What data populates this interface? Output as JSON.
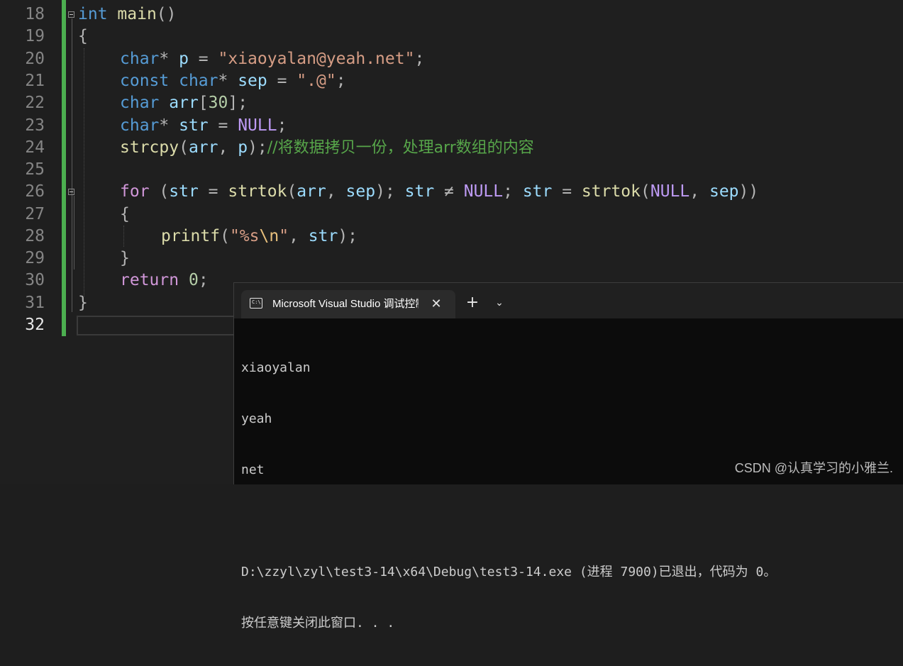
{
  "editor": {
    "line_numbers": [
      "18",
      "19",
      "20",
      "21",
      "22",
      "23",
      "24",
      "25",
      "26",
      "27",
      "28",
      "29",
      "30",
      "31",
      "32"
    ],
    "lines": {
      "l18": {
        "t1": "int",
        "t2": " ",
        "t3": "main",
        "t4": "()"
      },
      "l19": {
        "t1": "{"
      },
      "l20": {
        "t1": "char",
        "t2": "* ",
        "t3": "p",
        "t4": " = ",
        "t5": "\"xiaoyalan@yeah.net\"",
        "t6": ";"
      },
      "l21": {
        "t1": "const",
        "t2": " ",
        "t3": "char",
        "t4": "* ",
        "t5": "sep",
        "t6": " = ",
        "t7": "\".@\"",
        "t8": ";"
      },
      "l22": {
        "t1": "char",
        "t2": " ",
        "t3": "arr",
        "t4": "[",
        "t5": "30",
        "t6": "];"
      },
      "l23": {
        "t1": "char",
        "t2": "* ",
        "t3": "str",
        "t4": " = ",
        "t5": "NULL",
        "t6": ";"
      },
      "l24": {
        "t1": "strcpy",
        "t2": "(",
        "t3": "arr",
        "t4": ", ",
        "t5": "p",
        "t6": ");",
        "t7": "//将数据拷贝一份，处理arr数组的内容"
      },
      "l26": {
        "t1": "for",
        "t2": " (",
        "t3": "str",
        "t4": " = ",
        "t5": "strtok",
        "t6": "(",
        "t7": "arr",
        "t8": ", ",
        "t9": "sep",
        "t10": "); ",
        "t11": "str",
        "t12": " ≠ ",
        "t13": "NULL",
        "t14": "; ",
        "t15": "str",
        "t16": " = ",
        "t17": "strtok",
        "t18": "(",
        "t19": "NULL",
        "t20": ", ",
        "t21": "sep",
        "t22": "))"
      },
      "l27": {
        "t1": "{"
      },
      "l28": {
        "t1": "printf",
        "t2": "(",
        "t3": "\"%s",
        "t4": "\\n",
        "t5": "\"",
        "t6": ", ",
        "t7": "str",
        "t8": ");"
      },
      "l29": {
        "t1": "}"
      },
      "l30": {
        "t1": "return",
        "t2": " ",
        "t3": "0",
        "t4": ";"
      },
      "l31": {
        "t1": "}"
      }
    }
  },
  "terminal": {
    "tab_title": "Microsoft Visual Studio 调试控制台",
    "tab_icon_text": "C:\\",
    "close_symbol": "✕",
    "new_tab_symbol": "+",
    "dropdown_symbol": "⌄",
    "output_lines": [
      "xiaoyalan",
      "yeah",
      "net",
      "",
      "D:\\zzyl\\zyl\\test3-14\\x64\\Debug\\test3-14.exe (进程 7900)已退出，代码为 0。",
      "按任意键关闭此窗口. . ."
    ]
  },
  "watermark": "CSDN @认真学习的小雅兰.",
  "colors": {
    "editor_bg": "#1f1f1f",
    "change_bar": "#4caf50",
    "keyword": "#569cd6",
    "control_keyword": "#d197d9",
    "function": "#dcdcaa",
    "string": "#d69d85",
    "comment": "#57a64a",
    "terminal_bg": "#0c0c0c"
  }
}
